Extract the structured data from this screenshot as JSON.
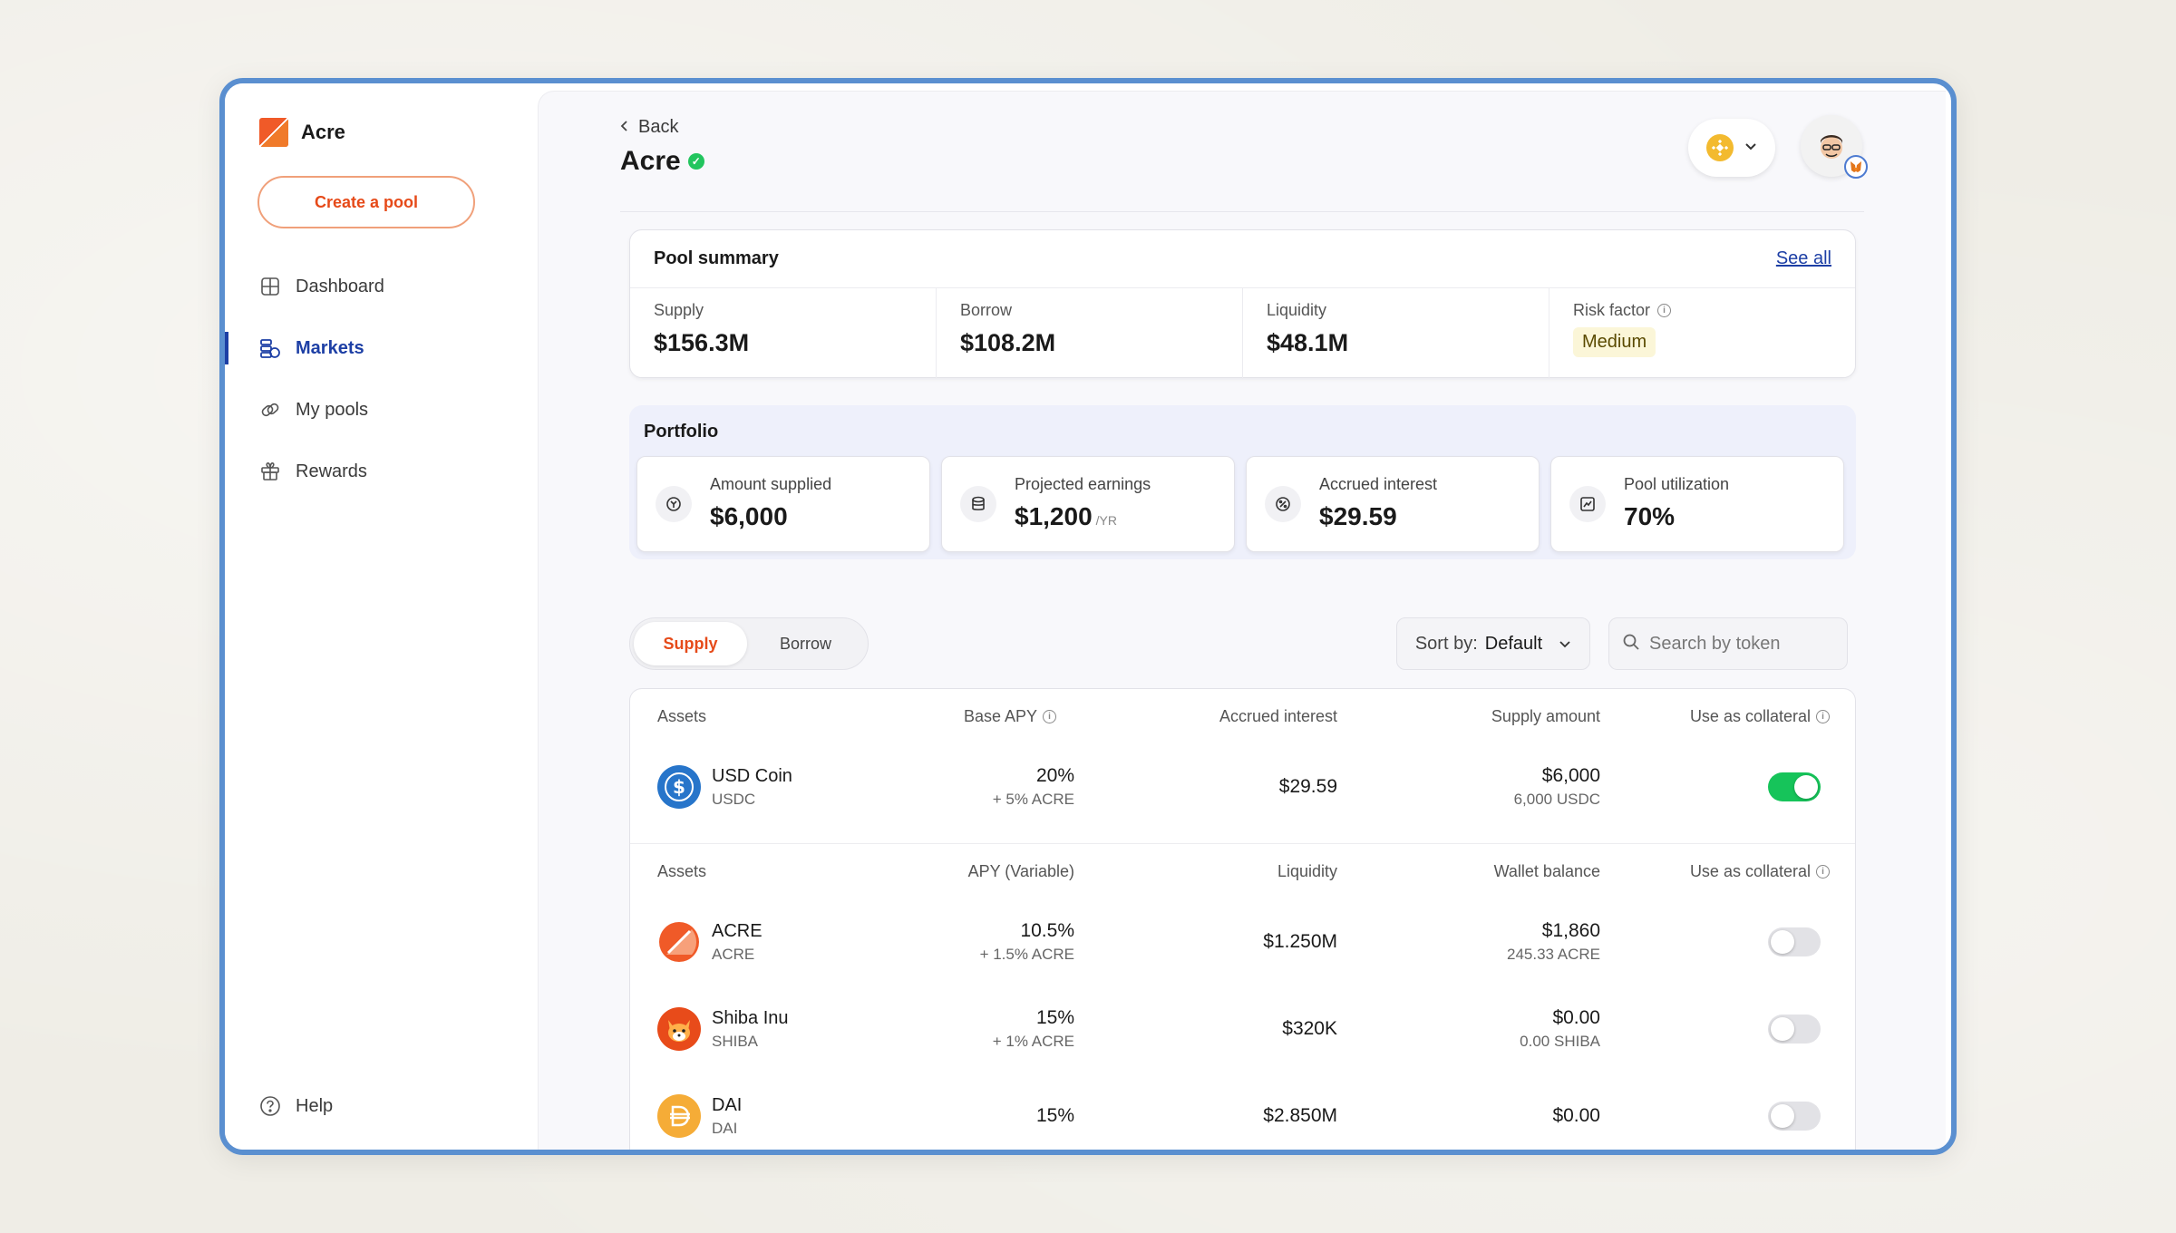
{
  "app": {
    "name": "Acre",
    "create_pool_label": "Create a pool",
    "help_label": "Help"
  },
  "nav": {
    "items": [
      {
        "label": "Dashboard",
        "icon": "grid-icon"
      },
      {
        "label": "Markets",
        "icon": "markets-icon",
        "active": true
      },
      {
        "label": "My pools",
        "icon": "link-icon"
      },
      {
        "label": "Rewards",
        "icon": "gift-icon"
      }
    ]
  },
  "header": {
    "back_label": "Back",
    "title": "Acre"
  },
  "summary": {
    "title": "Pool summary",
    "see_all": "See all",
    "stats": [
      {
        "label": "Supply",
        "value": "$156.3M"
      },
      {
        "label": "Borrow",
        "value": "$108.2M"
      },
      {
        "label": "Liquidity",
        "value": "$48.1M"
      },
      {
        "label": "Risk factor",
        "value": "Medium"
      }
    ]
  },
  "portfolio": {
    "title": "Portfolio",
    "cards": [
      {
        "label": "Amount supplied",
        "value": "$6,000",
        "unit": ""
      },
      {
        "label": "Projected earnings",
        "value": "$1,200",
        "unit": "/YR"
      },
      {
        "label": "Accrued interest",
        "value": "$29.59",
        "unit": ""
      },
      {
        "label": "Pool utilization",
        "value": "70%",
        "unit": ""
      }
    ]
  },
  "controls": {
    "tabs": [
      "Supply",
      "Borrow"
    ],
    "sort_prefix": "Sort by:",
    "sort_value": "Default",
    "search_placeholder": "Search by token"
  },
  "supplied": {
    "headers": [
      "Assets",
      "Base APY",
      "Accrued interest",
      "Supply amount",
      "Use as collateral"
    ],
    "rows": [
      {
        "name": "USD Coin",
        "symbol": "USDC",
        "apy": "20%",
        "apy_sub": "+ 5% ACRE",
        "col3": "$29.59",
        "amount": "$6,000",
        "amount_sub": "6,000 USDC",
        "collateral": true
      }
    ]
  },
  "available": {
    "headers": [
      "Assets",
      "APY (Variable)",
      "Liquidity",
      "Wallet balance",
      "Use as collateral"
    ],
    "rows": [
      {
        "name": "ACRE",
        "symbol": "ACRE",
        "apy": "10.5%",
        "apy_sub": "+ 1.5% ACRE",
        "col3": "$1.250M",
        "amount": "$1,860",
        "amount_sub": "245.33 ACRE",
        "collateral": false
      },
      {
        "name": "Shiba Inu",
        "symbol": "SHIBA",
        "apy": "15%",
        "apy_sub": "+ 1% ACRE",
        "col3": "$320K",
        "amount": "$0.00",
        "amount_sub": "0.00 SHIBA",
        "collateral": false
      },
      {
        "name": "DAI",
        "symbol": "DAI",
        "apy": "15%",
        "apy_sub": "",
        "col3": "$2.850M",
        "amount": "$0.00",
        "amount_sub": "",
        "collateral": false
      }
    ]
  },
  "colors": {
    "accent": "#1d3fa5",
    "brand": "#e64a19",
    "toggle_on": "#16c45a",
    "frame": "#5a8fd0"
  }
}
